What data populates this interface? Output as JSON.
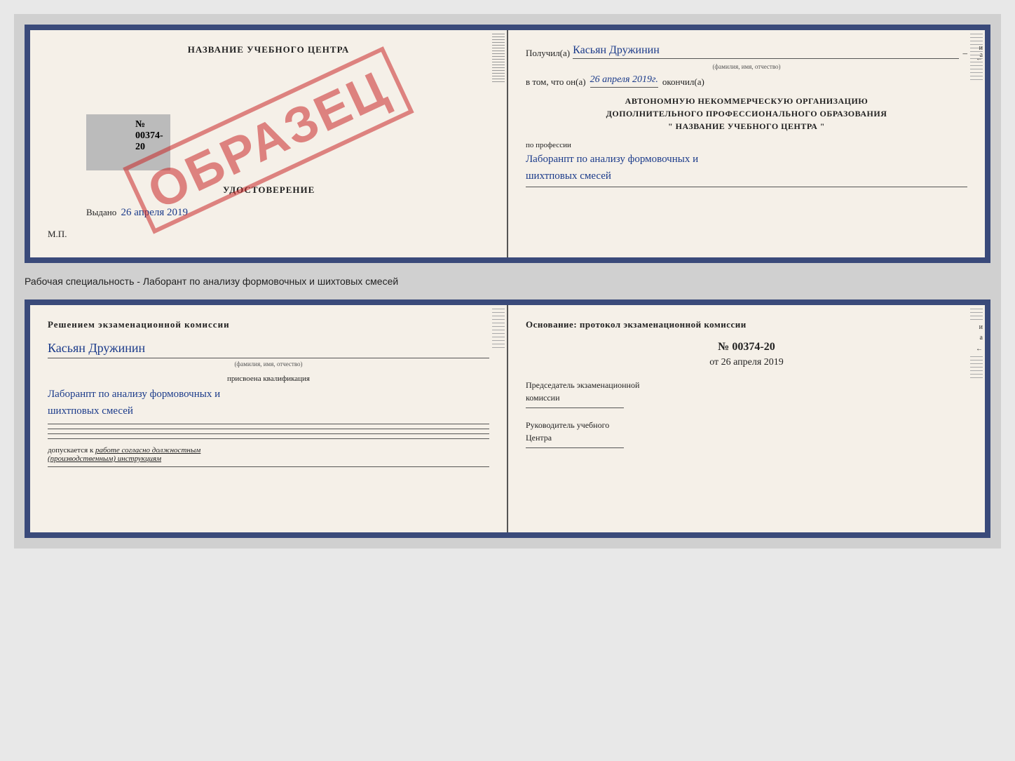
{
  "upper_doc": {
    "left": {
      "title": "НАЗВАНИЕ УЧЕБНОГО ЦЕНТРА",
      "gray_box": true,
      "udostoverenie_label": "УДОСТОВЕРЕНИЕ",
      "number": "№ 00374-20",
      "vydano_label": "Выдано",
      "vydano_date": "26 апреля 2019",
      "mp_label": "М.П.",
      "stamp_text": "ОБРАЗЕЦ"
    },
    "right": {
      "poluchil_label": "Получил(а)",
      "poluchil_name": "Касьян Дружинин",
      "fio_label": "(фамилия, имя, отчество)",
      "vtom_label": "в том, что он(а)",
      "vtom_date": "26 апреля 2019г.",
      "okoncil_label": "окончил(а)",
      "org_line1": "АВТОНОМНУЮ НЕКОММЕРЧЕСКУЮ ОРГАНИЗАЦИЮ",
      "org_line2": "ДОПОЛНИТЕЛЬНОГО ПРОФЕССИОНАЛЬНОГО ОБРАЗОВАНИЯ",
      "org_line3": "\"  НАЗВАНИЕ УЧЕБНОГО ЦЕНТРА  \"",
      "po_professii_label": "по профессии",
      "professiya_text_line1": "Лаборанпт по анализу формовочных и",
      "professiya_text_line2": "шихтповых смесей"
    }
  },
  "separator": {
    "text": "Рабочая специальность - Лаборант по анализу формовочных и шихтовых смесей"
  },
  "lower_doc": {
    "left": {
      "commission_title": "Решением  экзаменационной  комиссии",
      "name": "Касьян Дружинин",
      "fio_label": "(фамилия, имя, отчество)",
      "prisvoena_label": "присвоена квалификация",
      "kvalifikaciya_line1": "Лаборанпт по анализу формовочных и",
      "kvalifikaciya_line2": "шихтповых смесей",
      "dopuskaetsya_label": "допускается к",
      "dopuskaetsya_text": "работе согласно должностным",
      "dopuskaetsya_text2": "(производственным) инструкциям"
    },
    "right": {
      "osnov_title": "Основание: протокол экзаменационной  комиссии",
      "proto_number": "№ 00374-20",
      "proto_ot": "от",
      "proto_date": "26 апреля 2019",
      "predsedatel_label": "Председатель экзаменационной",
      "komissii_label": "комиссии",
      "rukovoditel_label": "Руководитель учебного",
      "centra_label": "Центра"
    }
  },
  "deco_lines_count": 18
}
